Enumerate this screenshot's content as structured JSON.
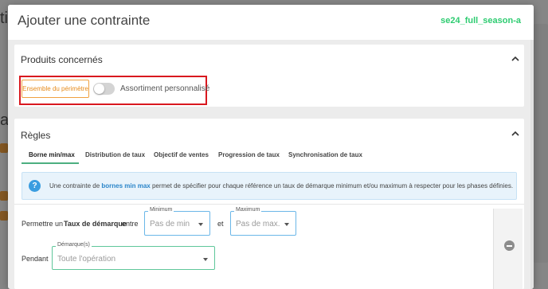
{
  "modal": {
    "title": "Ajouter une contrainte",
    "season_code": "se24_full_season-a"
  },
  "products_section": {
    "title": "Produits concernés",
    "perimeter_button": "Ensemble du périmètre",
    "toggle_label": "Assortiment personnalisé",
    "toggle_on": false
  },
  "rules_section": {
    "title": "Règles",
    "tabs": [
      {
        "label": "Borne min/max",
        "active": true
      },
      {
        "label": "Distribution de taux",
        "active": false
      },
      {
        "label": "Objectif de ventes",
        "active": false
      },
      {
        "label": "Progression de taux",
        "active": false
      },
      {
        "label": "Synchronisation de taux",
        "active": false
      }
    ],
    "info": {
      "prefix": "Une contrainte de ",
      "highlight": "bornes min max",
      "suffix": " permet de spécifier pour chaque référence un taux de démarque minimum et/ou maximum à respecter pour les phases définies."
    },
    "row1": {
      "label_permettre": "Permettre un",
      "label_taux": "Taux de démarque",
      "label_entre": "entre",
      "label_et": "et",
      "minimum": {
        "legend": "Minimum",
        "placeholder": "Pas de min"
      },
      "maximum": {
        "legend": "Maximum",
        "placeholder": "Pas de max."
      }
    },
    "row2": {
      "label_pendant": "Pendant",
      "demarque": {
        "legend": "Démarque(s)",
        "placeholder": "Toute l'opération"
      }
    }
  },
  "colors": {
    "accent_green": "#2ecc71",
    "orange": "#e68a1a",
    "highlight_red": "#d9181f",
    "info_blue": "#3a9de0"
  }
}
